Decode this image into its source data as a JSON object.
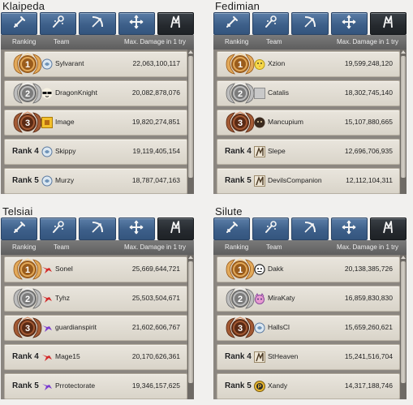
{
  "header_labels": {
    "ranking": "Ranking",
    "team": "Team",
    "damage": "Max. Damage in 1 try"
  },
  "tab_icons": [
    "sword-icon",
    "staff-icon",
    "bow-icon",
    "cross-icon",
    "scout-icon"
  ],
  "colors": {
    "tab_blue": "#3d5f89",
    "tab_active": "#25292e",
    "gold": "#c48a3a",
    "silver": "#9a9a9a",
    "bronze": "#8a4a2a"
  },
  "panels": [
    {
      "name": "Klaipeda",
      "rows": [
        {
          "rank": "1",
          "rank_label": "",
          "team": "Sylvarant",
          "damage": "22,063,100,117",
          "avatar": "swirl-icon",
          "medal": "gold"
        },
        {
          "rank": "2",
          "rank_label": "",
          "team": "DragonKnight",
          "damage": "20,082,878,076",
          "avatar": "sunglasses-icon",
          "medal": "silver"
        },
        {
          "rank": "3",
          "rank_label": "",
          "team": "Image",
          "damage": "19,820,274,851",
          "avatar": "yellow-square-icon",
          "medal": "bronze"
        },
        {
          "rank": "4",
          "rank_label": "Rank 4",
          "team": "Skippy",
          "damage": "19,119,405,154",
          "avatar": "swirl-icon",
          "medal": ""
        },
        {
          "rank": "5",
          "rank_label": "Rank 5",
          "team": "Murzy",
          "damage": "18,787,047,163",
          "avatar": "swirl-icon",
          "medal": ""
        }
      ]
    },
    {
      "name": "Fedimian",
      "rows": [
        {
          "rank": "1",
          "rank_label": "",
          "team": "Xzion",
          "damage": "19,599,248,120",
          "avatar": "chick-icon",
          "medal": "gold"
        },
        {
          "rank": "2",
          "rank_label": "",
          "team": "Catalis",
          "damage": "18,302,745,140",
          "avatar": "gray-square-icon",
          "medal": "silver"
        },
        {
          "rank": "3",
          "rank_label": "",
          "team": "Mancupium",
          "damage": "15,107,880,665",
          "avatar": "dark-face-icon",
          "medal": "bronze"
        },
        {
          "rank": "4",
          "rank_label": "Rank 4",
          "team": "Slepe",
          "damage": "12,696,706,935",
          "avatar": "figure-icon",
          "medal": ""
        },
        {
          "rank": "5",
          "rank_label": "Rank 5",
          "team": "DevilsCompanion",
          "damage": "12,112,104,311",
          "avatar": "figure-icon",
          "medal": ""
        }
      ]
    },
    {
      "name": "Telsiai",
      "rows": [
        {
          "rank": "1",
          "rank_label": "",
          "team": "Sonel",
          "damage": "25,669,644,721",
          "avatar": "red-bird-icon",
          "medal": "gold"
        },
        {
          "rank": "2",
          "rank_label": "",
          "team": "Tyhz",
          "damage": "25,503,504,671",
          "avatar": "red-bird-icon",
          "medal": "silver"
        },
        {
          "rank": "3",
          "rank_label": "",
          "team": "guardianspirit",
          "damage": "21,602,606,767",
          "avatar": "purple-bird-icon",
          "medal": "bronze"
        },
        {
          "rank": "4",
          "rank_label": "Rank 4",
          "team": "Mage15",
          "damage": "20,170,626,361",
          "avatar": "red-bird-icon",
          "medal": ""
        },
        {
          "rank": "5",
          "rank_label": "Rank 5",
          "team": "Prrotectorate",
          "damage": "19,346,157,625",
          "avatar": "purple-bird-icon",
          "medal": ""
        }
      ]
    },
    {
      "name": "Silute",
      "rows": [
        {
          "rank": "1",
          "rank_label": "",
          "team": "Dakk",
          "damage": "20,138,385,726",
          "avatar": "face-outline-icon",
          "medal": "gold"
        },
        {
          "rank": "2",
          "rank_label": "",
          "team": "MiraKaty",
          "damage": "16,859,830,830",
          "avatar": "cat-icon",
          "medal": "silver"
        },
        {
          "rank": "3",
          "rank_label": "",
          "team": "HallsCl",
          "damage": "15,659,260,621",
          "avatar": "swirl-icon",
          "medal": "bronze"
        },
        {
          "rank": "4",
          "rank_label": "Rank 4",
          "team": "StHeaven",
          "damage": "15,241,516,704",
          "avatar": "figure-icon",
          "medal": ""
        },
        {
          "rank": "5",
          "rank_label": "Rank 5",
          "team": "Xandy",
          "damage": "14,317,188,746",
          "avatar": "coin-icon",
          "medal": ""
        }
      ]
    }
  ]
}
